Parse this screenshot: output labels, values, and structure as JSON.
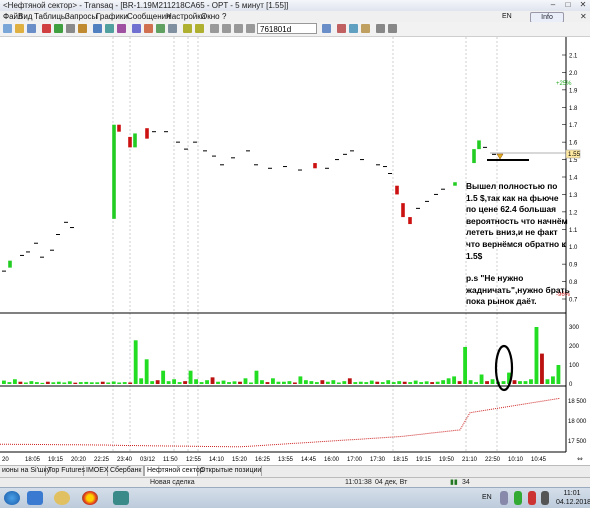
{
  "window": {
    "title": "<Нефтяной сектор> - Transaq - [BR-1.19M211218CA65 - OPT - 5 минут [1.55]]"
  },
  "menu": [
    "Файл",
    "Вид",
    "Таблицы",
    "Запросы",
    "Графики",
    "Сообщения",
    "Настройки",
    "Окно",
    "?"
  ],
  "menu_lang": "EN",
  "info_button": "Info",
  "toolbar": {
    "symbol": "761801d"
  },
  "price_axis": [
    "2.1",
    "2.0",
    "1.9",
    "1.8",
    "1.7",
    "1.6",
    "1.5",
    "1.4",
    "1.3",
    "1.2",
    "1.1",
    "1.0",
    "0.9",
    "0.8",
    "0.7"
  ],
  "price_label_current": "1.55",
  "pct_top": "+25%",
  "pct_bottom": "-96%",
  "volume_axis": [
    "300",
    "200",
    "100",
    "0"
  ],
  "bottom_axis": [
    "18 500",
    "18 000",
    "17 500"
  ],
  "time_axis": [
    "20",
    "18:05",
    "19:15",
    "20:20",
    "22:25",
    "23:40",
    "03/12",
    "11:50",
    "12:55",
    "14:10",
    "15:20",
    "16:25",
    "13:55",
    "14:45",
    "16:00",
    "17:00",
    "17:30",
    "18:15",
    "19:15",
    "19:50",
    "21:10",
    "22:50",
    "10:10",
    "10:45"
  ],
  "annotation": {
    "main": "Вышел полностью по 1.5 $,так как на фьюче по цене 62.4 большая вероятность что начнём лететь вниз,и не факт что вернёмся обратно к 1.5$",
    "ps": "p.s \"Не нужно жадничать\",нужно брать пока рынок даёт."
  },
  "tabs": [
    "ионы на Si'шку",
    "Top Futures",
    "IMOEX",
    "Сбербанк",
    "Нефтяной сектор",
    "Открытые позиции"
  ],
  "status": {
    "new_deal": "Новая сделка",
    "time": "11:01:38",
    "date": "04 дек, Вт",
    "count": "34"
  },
  "taskbar": {
    "lang": "EN",
    "clock_time": "11:01",
    "clock_date": "04.12.2018"
  },
  "chart_data": {
    "type": "candlestick",
    "timeframe": "5 минут",
    "ylim": [
      0.7,
      2.1
    ],
    "candles": [
      {
        "o": 0.86,
        "c": 0.86
      },
      {
        "o": 0.88,
        "c": 0.92
      },
      {
        "o": 0.95,
        "c": 0.95
      },
      {
        "o": 0.97,
        "c": 0.97
      },
      {
        "o": 1.02,
        "c": 1.02
      },
      {
        "o": 0.94,
        "c": 0.94
      },
      {
        "o": 0.98,
        "c": 0.98
      },
      {
        "o": 1.07,
        "c": 1.07
      },
      {
        "o": 1.14,
        "c": 1.14
      },
      {
        "o": 1.11,
        "c": 1.11
      },
      {
        "o": 1.16,
        "c": 1.7
      },
      {
        "o": 1.7,
        "c": 1.66
      },
      {
        "o": 1.63,
        "c": 1.57
      },
      {
        "o": 1.57,
        "c": 1.65
      },
      {
        "o": 1.68,
        "c": 1.62
      },
      {
        "o": 1.66,
        "c": 1.66
      },
      {
        "o": 1.66,
        "c": 1.66
      },
      {
        "o": 1.6,
        "c": 1.6
      },
      {
        "o": 1.56,
        "c": 1.56
      },
      {
        "o": 1.6,
        "c": 1.6
      },
      {
        "o": 1.55,
        "c": 1.55
      },
      {
        "o": 1.52,
        "c": 1.52
      },
      {
        "o": 1.47,
        "c": 1.47
      },
      {
        "o": 1.51,
        "c": 1.51
      },
      {
        "o": 1.55,
        "c": 1.55
      },
      {
        "o": 1.47,
        "c": 1.47
      },
      {
        "o": 1.45,
        "c": 1.45
      },
      {
        "o": 1.46,
        "c": 1.46
      },
      {
        "o": 1.44,
        "c": 1.44
      },
      {
        "o": 1.48,
        "c": 1.45
      },
      {
        "o": 1.45,
        "c": 1.45
      },
      {
        "o": 1.5,
        "c": 1.5
      },
      {
        "o": 1.53,
        "c": 1.53
      },
      {
        "o": 1.55,
        "c": 1.55
      },
      {
        "o": 1.5,
        "c": 1.5
      },
      {
        "o": 1.47,
        "c": 1.47
      },
      {
        "o": 1.46,
        "c": 1.46
      },
      {
        "o": 1.42,
        "c": 1.42
      },
      {
        "o": 1.35,
        "c": 1.3
      },
      {
        "o": 1.25,
        "c": 1.17
      },
      {
        "o": 1.17,
        "c": 1.13
      },
      {
        "o": 1.22,
        "c": 1.22
      },
      {
        "o": 1.26,
        "c": 1.26
      },
      {
        "o": 1.3,
        "c": 1.3
      },
      {
        "o": 1.33,
        "c": 1.33
      },
      {
        "o": 1.35,
        "c": 1.37
      },
      {
        "o": 1.48,
        "c": 1.56
      },
      {
        "o": 1.56,
        "c": 1.61
      },
      {
        "o": 1.57,
        "c": 1.57
      },
      {
        "o": 1.53,
        "c": 1.53
      }
    ],
    "volumes": [
      18,
      10,
      25,
      12,
      8,
      15,
      10,
      6,
      12,
      9,
      12,
      8,
      14,
      7,
      10,
      11,
      9,
      9,
      12,
      8,
      13,
      8,
      10,
      8,
      230,
      30,
      130,
      15,
      20,
      70,
      15,
      25,
      10,
      15,
      70,
      25,
      10,
      20,
      35,
      12,
      18,
      10,
      14,
      12,
      30,
      8,
      70,
      20,
      10,
      30,
      12,
      12,
      15,
      8,
      40,
      20,
      15,
      10,
      20,
      12,
      20,
      8,
      15,
      30,
      10,
      12,
      10,
      18,
      12,
      10,
      20,
      10,
      15,
      12,
      10,
      18,
      10,
      14,
      10,
      12,
      20,
      30,
      40,
      15,
      195,
      20,
      10,
      50,
      15,
      25,
      12,
      15,
      60,
      20,
      15,
      15,
      25,
      300,
      160,
      25,
      40,
      100
    ],
    "volume_colors": "mostly green, some red",
    "volume_ylim": [
      0,
      300
    ],
    "lower_panel_ylim": [
      17300,
      18800
    ]
  }
}
